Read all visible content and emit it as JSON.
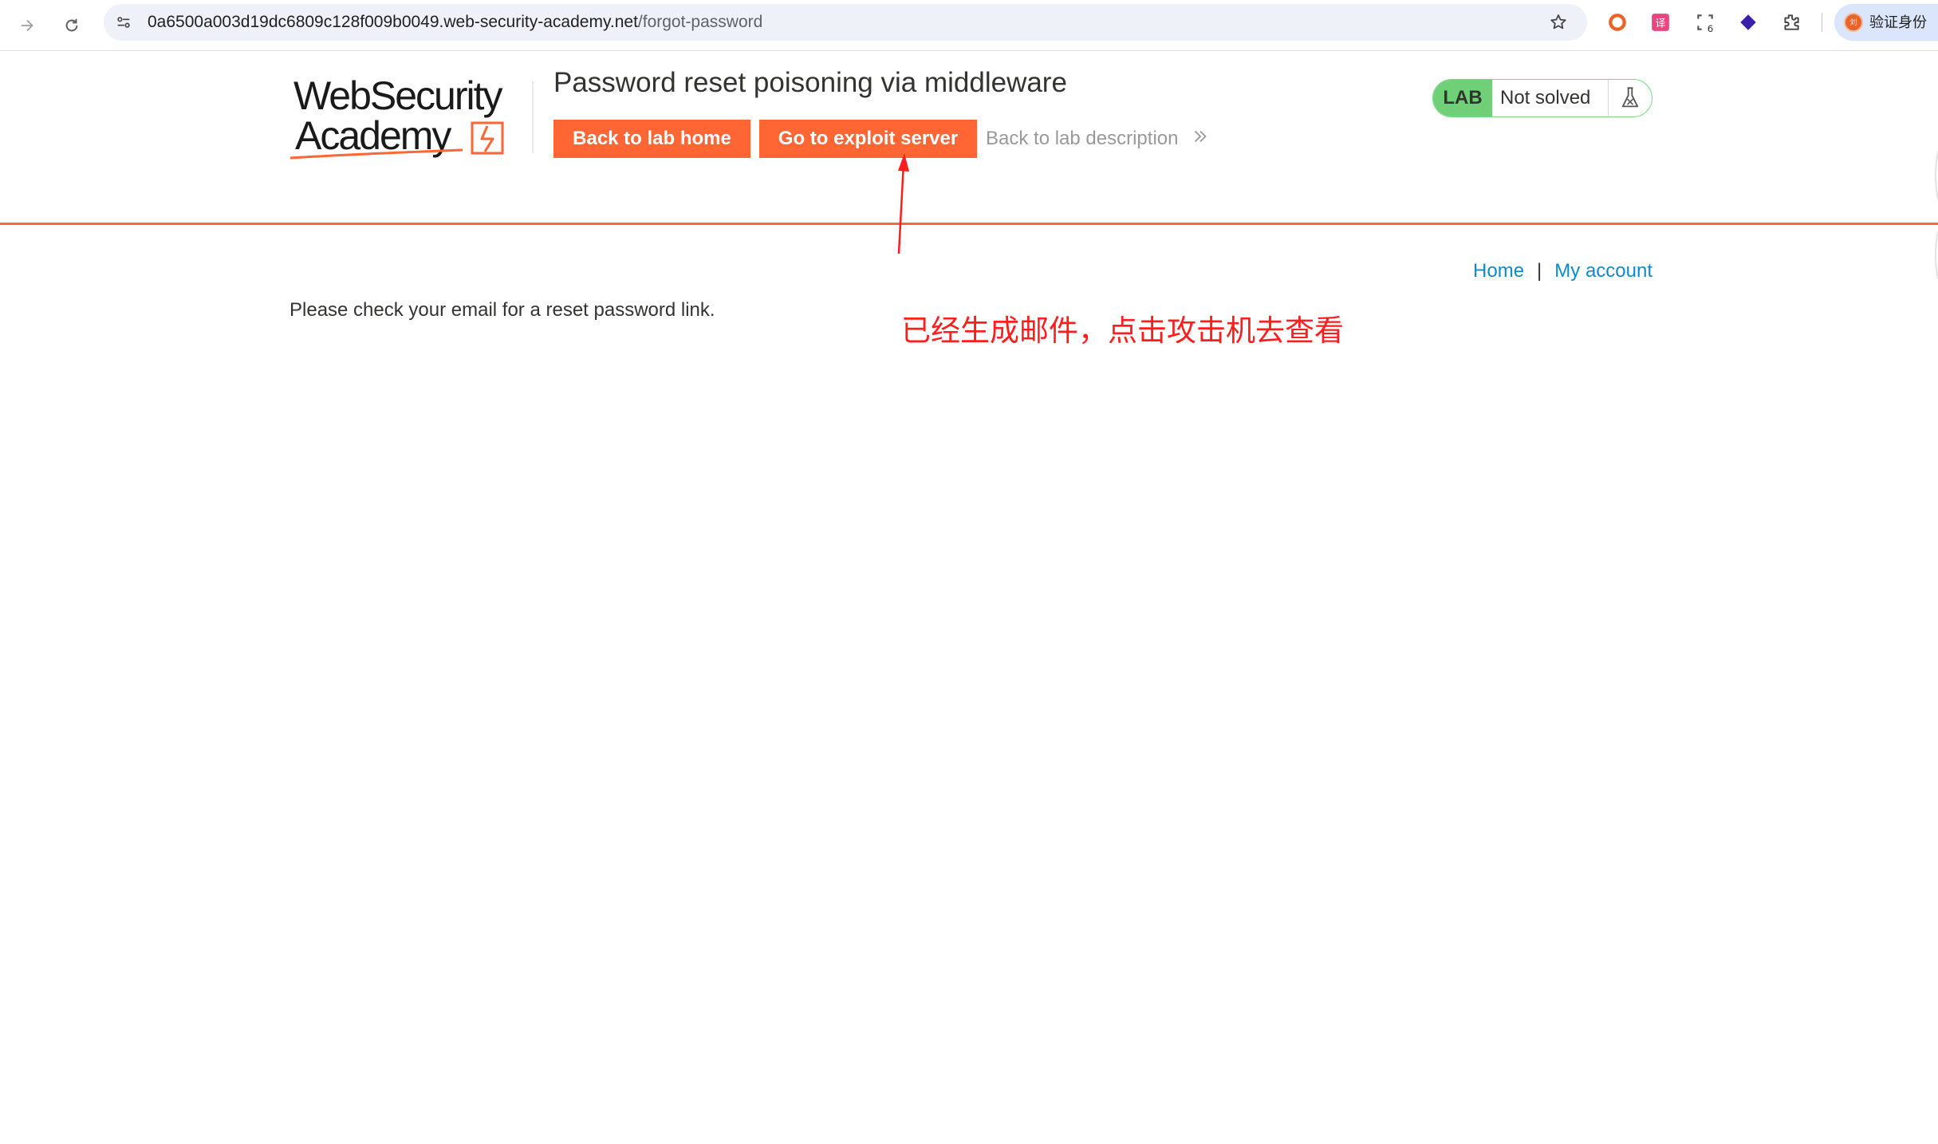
{
  "browser": {
    "url_host": "0a6500a003d19dc6809c128f009b0049.web-security-academy.net",
    "url_path": "/forgot-password",
    "profile_label": "验证身份",
    "profile_avatar_text": "刘",
    "extension_badge": "6"
  },
  "header": {
    "logo_line1": "WebSecurity",
    "logo_line2": "Academy",
    "lab_title": "Password reset poisoning via middleware",
    "back_to_lab_home": "Back to lab home",
    "go_to_exploit_server": "Go to exploit server",
    "back_to_lab_description": "Back to lab description",
    "lab_tag": "LAB",
    "lab_status": "Not solved",
    "accent_color": "#ff6633",
    "status_color": "#70d078"
  },
  "nav": {
    "home": "Home",
    "separator": "|",
    "my_account": "My account"
  },
  "main": {
    "message": "Please check your email for a reset password link."
  },
  "annotation": {
    "text": "已经生成邮件，点击攻击机去查看",
    "color": "#ff1d1d"
  },
  "icons": {
    "back": "arrow-forward-icon",
    "reload": "reload-icon",
    "site_info": "tune-icon",
    "bookmark": "star-icon",
    "extensions": "puzzle-icon",
    "lab_flask": "flask-icon"
  }
}
